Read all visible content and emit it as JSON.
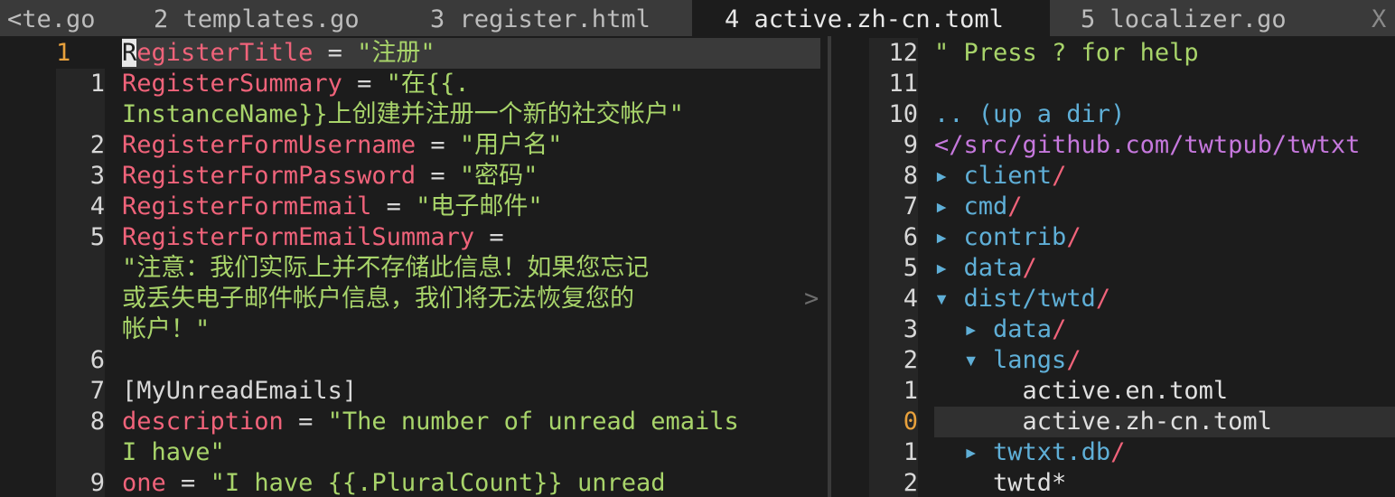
{
  "tabs": [
    {
      "label": "<te.go"
    },
    {
      "label": "2 templates.go"
    },
    {
      "label": "3 register.html"
    },
    {
      "label": "4 active.zh-cn.toml"
    },
    {
      "label": "5 localizer.go"
    }
  ],
  "close_label": "X",
  "editor": {
    "lines": [
      {
        "num": "1",
        "cursor_char": "R",
        "key": "egisterTitle",
        "eq": " = ",
        "str": "\"注册\""
      },
      {
        "num": "1",
        "key": "RegisterSummary",
        "eq": " = ",
        "str": "\"在{{."
      },
      {
        "num": "",
        "str": "InstanceName}}上创建并注册一个新的社交帐户\""
      },
      {
        "num": "2",
        "key": "RegisterFormUsername",
        "eq": " = ",
        "str": "\"用户名\""
      },
      {
        "num": "3",
        "key": "RegisterFormPassword",
        "eq": " = ",
        "str": "\"密码\""
      },
      {
        "num": "4",
        "key": "RegisterFormEmail",
        "eq": " = ",
        "str": "\"电子邮件\""
      },
      {
        "num": "5",
        "key": "RegisterFormEmailSummary",
        "eq": " = "
      },
      {
        "num": "",
        "str": "\"注意：我们实际上并不存储此信息！如果您忘记"
      },
      {
        "num": "",
        "str": "或丢失电子邮件帐户信息，我们将无法恢复您的",
        "more": ">"
      },
      {
        "num": "",
        "str": "帐户！\""
      },
      {
        "num": "6"
      },
      {
        "num": "7",
        "plain": "[MyUnreadEmails]"
      },
      {
        "num": "8",
        "key": "description",
        "eq": " = ",
        "str": "\"The number of unread emails"
      },
      {
        "num": "",
        "str": "I have\""
      },
      {
        "num": "9",
        "key": "one",
        "eq": " = ",
        "str": "\"I have {{.PluralCount}} unread"
      }
    ]
  },
  "tree": {
    "rows": [
      {
        "num": "12",
        "help": "\" Press ? for help"
      },
      {
        "num": "11"
      },
      {
        "num": "10",
        "updir": ".. (up a dir)"
      },
      {
        "num": "9",
        "path": "</src/github.com/twtpub/twtxt"
      },
      {
        "num": "8",
        "arrow": "▸ ",
        "name": "client",
        "slash": "/"
      },
      {
        "num": "7",
        "arrow": "▸ ",
        "name": "cmd",
        "slash": "/"
      },
      {
        "num": "6",
        "arrow": "▸ ",
        "name": "contrib",
        "slash": "/"
      },
      {
        "num": "5",
        "arrow": "▸ ",
        "name": "data",
        "slash": "/"
      },
      {
        "num": "4",
        "arrow": "▾ ",
        "name": "dist/twtd",
        "slash": "/"
      },
      {
        "num": "3",
        "indent": "  ",
        "arrow": "▸ ",
        "name": "data",
        "slash": "/"
      },
      {
        "num": "2",
        "indent": "  ",
        "arrow": "▾ ",
        "name": "langs",
        "slash": "/"
      },
      {
        "num": "1",
        "indent": "      ",
        "file": "active.en.toml"
      },
      {
        "num": "0",
        "indent": "      ",
        "file": "active.zh-cn.toml",
        "current": true
      },
      {
        "num": "1",
        "indent": "  ",
        "arrow": "▸ ",
        "name": "twtxt.db",
        "slash": "/"
      },
      {
        "num": "2",
        "indent": "    ",
        "file": "twtd*"
      }
    ]
  }
}
